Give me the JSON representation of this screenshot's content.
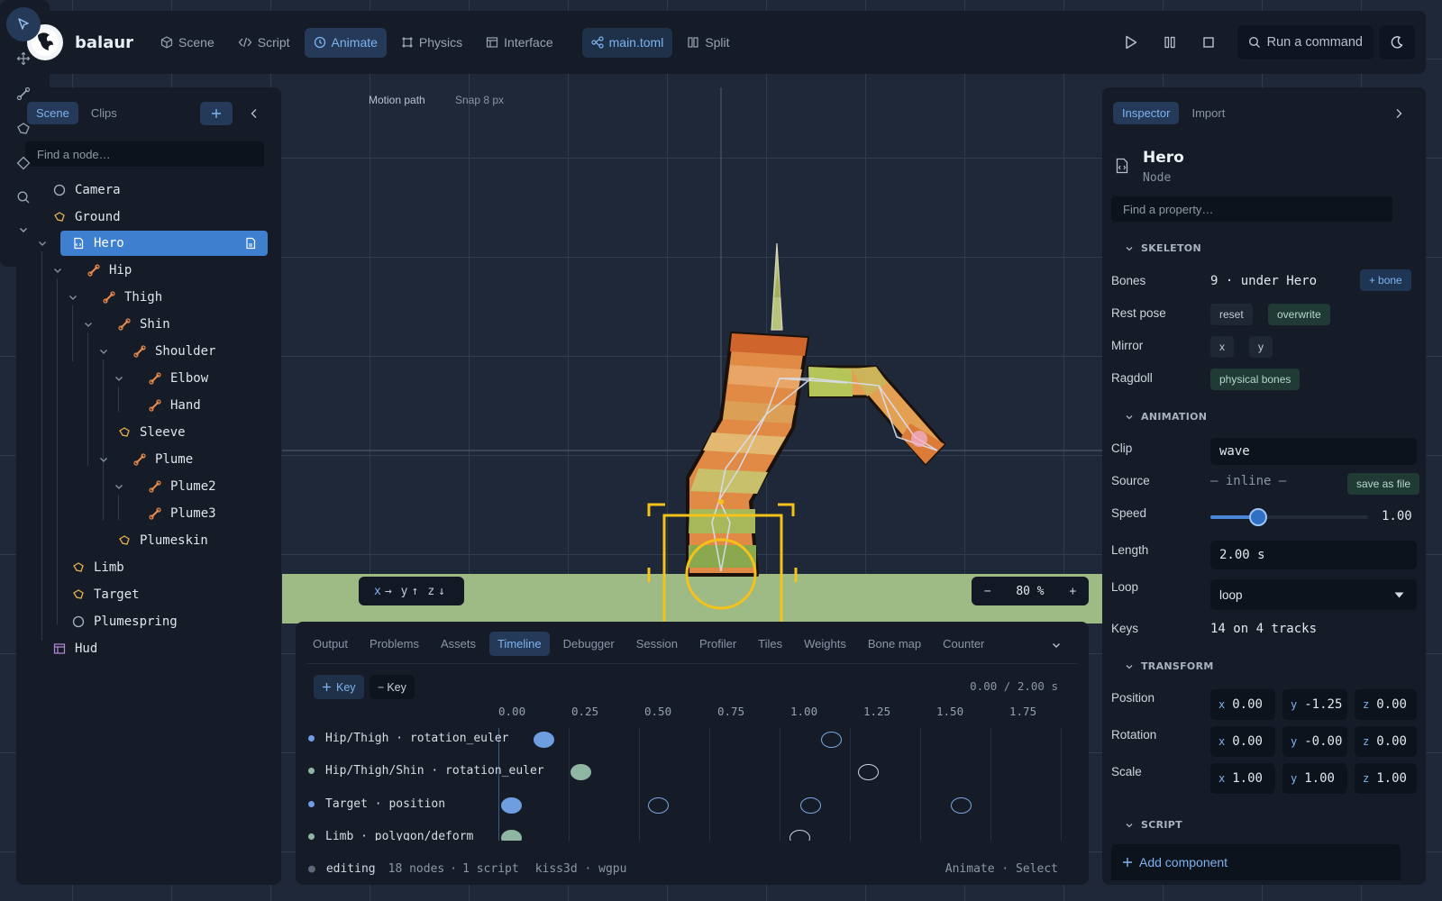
{
  "app": {
    "name": "balaur"
  },
  "nav": {
    "tabs": [
      {
        "label": "Scene"
      },
      {
        "label": "Script"
      },
      {
        "label": "Animate"
      },
      {
        "label": "Physics"
      },
      {
        "label": "Interface"
      }
    ],
    "file": "main.toml",
    "split": "Split",
    "command": "Run a command"
  },
  "left": {
    "tabs": [
      "Scene",
      "Clips"
    ],
    "search_placeholder": "Find a node…",
    "nodes": [
      "Camera",
      "Ground",
      "Hero",
      "Hip",
      "Thigh",
      "Shin",
      "Shoulder",
      "Elbow",
      "Hand",
      "Sleeve",
      "Plume",
      "Plume2",
      "Plume3",
      "Plumeskin",
      "Limb",
      "Target",
      "Plumespring",
      "Hud"
    ]
  },
  "viewport": {
    "motion_path": "Motion path",
    "snap": "Snap 8 px",
    "axes": {
      "x": "x",
      "x_arrow": "→",
      "y": "y",
      "y_arrow": "↑",
      "z": "z",
      "z_arrow": "↓"
    },
    "zoom": {
      "minus": "−",
      "value": "80 %",
      "plus": "+"
    }
  },
  "bottom": {
    "tabs": [
      "Output",
      "Problems",
      "Assets",
      "Timeline",
      "Debugger",
      "Session",
      "Profiler",
      "Tiles",
      "Weights",
      "Bone map",
      "Counter"
    ],
    "add_key": "Key",
    "remove_key": "Key",
    "time": "0.00 / 2.00 s",
    "ruler": [
      "0.00",
      "0.25",
      "0.50",
      "0.75",
      "1.00",
      "1.25",
      "1.50",
      "1.75"
    ],
    "tracks": [
      {
        "label": "Hip/Thigh · rotation_euler",
        "dot": "#6e9ee0"
      },
      {
        "label": "Hip/Thigh/Shin · rotation_euler",
        "dot": "#8fb6a2"
      },
      {
        "label": "Target · position",
        "dot": "#6e9ee0"
      },
      {
        "label": "Limb · polygon/deform",
        "dot": "#8fb6a2"
      }
    ],
    "status": {
      "state": "editing",
      "nodes": "18 nodes",
      "script": "1 script",
      "backend": "kiss3d · wgpu",
      "mode": "Animate · Select"
    }
  },
  "inspector": {
    "tabs": [
      "Inspector",
      "Import"
    ],
    "title": "Hero",
    "subtitle": "Node",
    "search_placeholder": "Find a property…",
    "skeleton": {
      "header": "SKELETON",
      "bones_label": "Bones",
      "bones_value": "9 · under Hero",
      "add_bone": "bone",
      "rest_label": "Rest pose",
      "reset": "reset",
      "overwrite": "overwrite",
      "mirror_label": "Mirror",
      "mirror_x": "x",
      "mirror_y": "y",
      "ragdoll_label": "Ragdoll",
      "ragdoll_btn": "physical bones"
    },
    "animation": {
      "header": "ANIMATION",
      "clip_label": "Clip",
      "clip_value": "wave",
      "source_label": "Source",
      "source_value": "— inline —",
      "save_file": "save as file",
      "speed_label": "Speed",
      "speed_value": "1.00",
      "speed": 1.0,
      "length_label": "Length",
      "length_value": "2.00 s",
      "loop_label": "Loop",
      "loop_value": "loop",
      "keys_label": "Keys",
      "keys_value": "14 on 4 tracks"
    },
    "transform": {
      "header": "TRANSFORM",
      "position_label": "Position",
      "position": {
        "x": "0.00",
        "y": "-1.25",
        "z": "0.00"
      },
      "rotation_label": "Rotation",
      "rotation": {
        "x": "0.00",
        "y": "-0.00",
        "z": "0.00"
      },
      "scale_label": "Scale",
      "scale": {
        "x": "1.00",
        "y": "1.00",
        "z": "1.00"
      }
    },
    "script": {
      "header": "SCRIPT",
      "add_component": "Add component"
    }
  },
  "colors": {
    "accent": "#7fb2ee",
    "selection": "#3e7fd0",
    "panel": "#151c28",
    "bone": "#e88a4a"
  }
}
